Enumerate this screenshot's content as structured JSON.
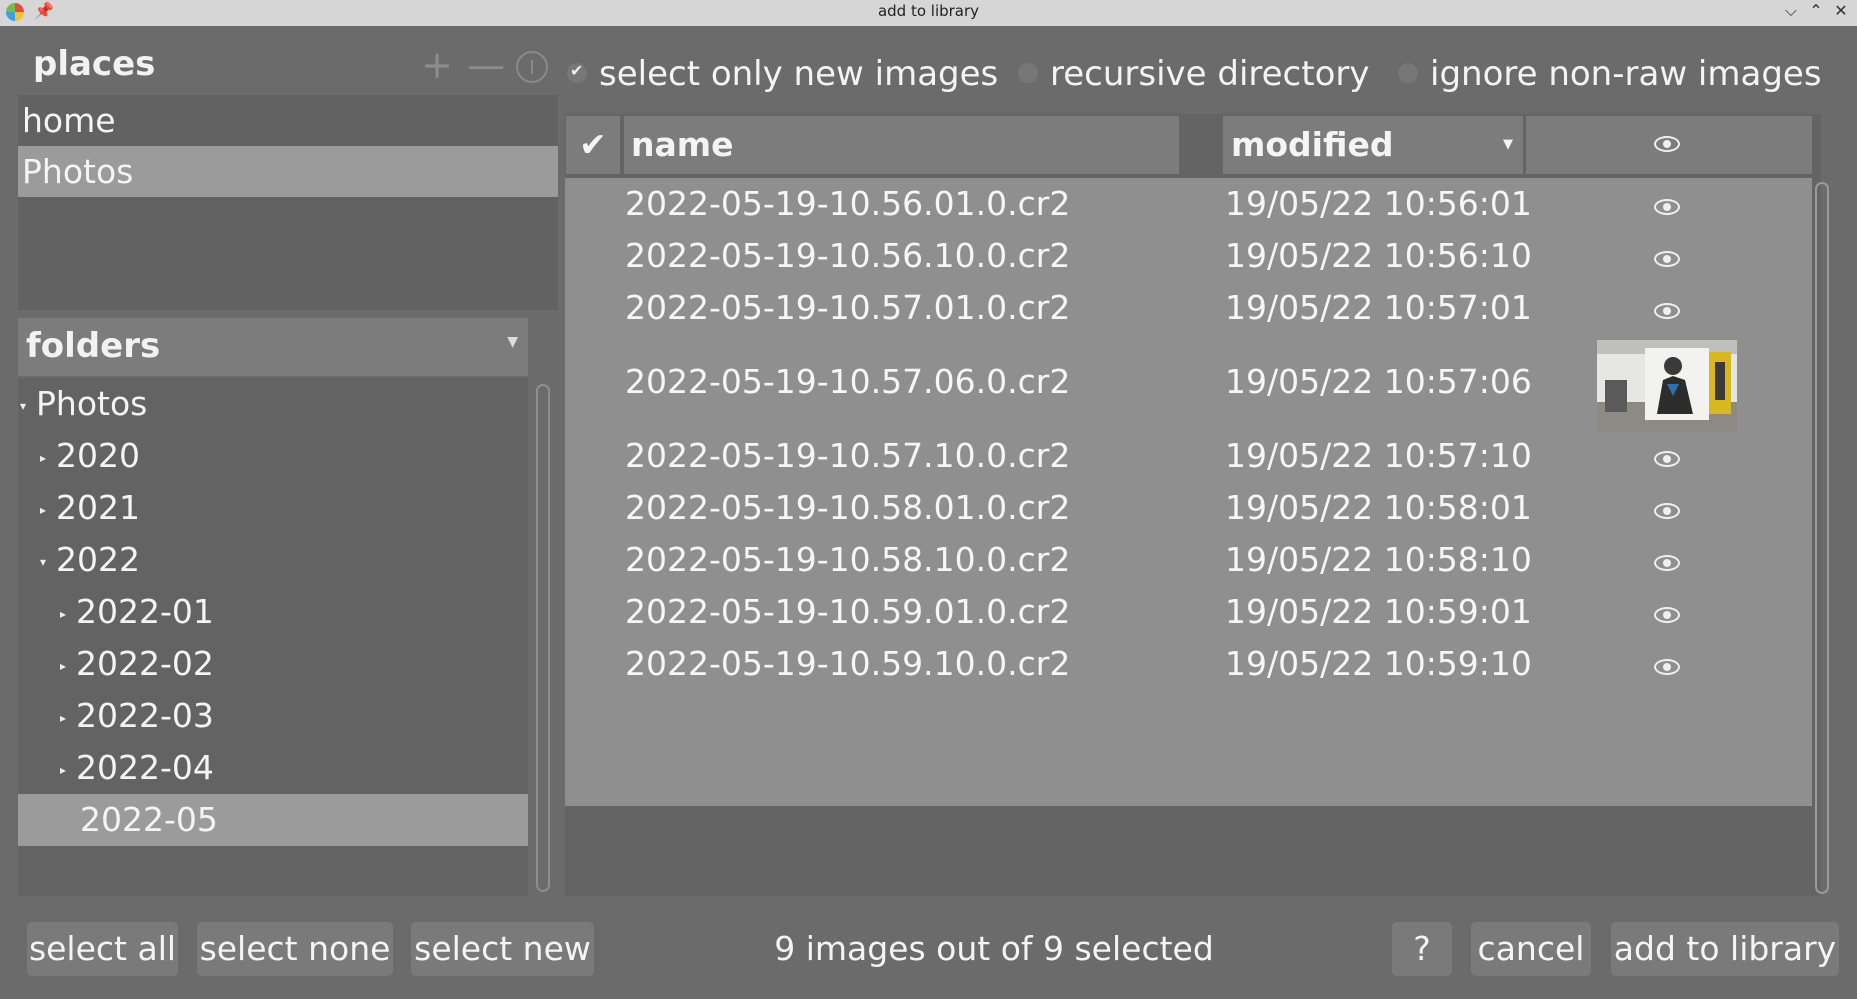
{
  "window": {
    "title": "add to library",
    "buttons": {
      "minimize": "⌵",
      "maximize": "⌃",
      "close": "✕"
    }
  },
  "places": {
    "title": "places",
    "add_label": "+",
    "remove_label": "—",
    "items": [
      {
        "label": "home",
        "selected": false
      },
      {
        "label": "Photos",
        "selected": true
      }
    ]
  },
  "folders": {
    "title": "folders",
    "items": [
      {
        "label": "Photos",
        "expanded": true,
        "selected": false
      },
      {
        "label": "2020",
        "expanded": false,
        "selected": false
      },
      {
        "label": "2021",
        "expanded": false,
        "selected": false
      },
      {
        "label": "2022",
        "expanded": true,
        "selected": false
      },
      {
        "label": "2022-01",
        "expanded": false,
        "selected": false
      },
      {
        "label": "2022-02",
        "expanded": false,
        "selected": false
      },
      {
        "label": "2022-03",
        "expanded": false,
        "selected": false
      },
      {
        "label": "2022-04",
        "expanded": false,
        "selected": false
      },
      {
        "label": "2022-05",
        "expanded": null,
        "selected": true
      }
    ]
  },
  "options": {
    "select_only_new": {
      "label": "select only new images",
      "checked": true
    },
    "recursive": {
      "label": "recursive directory",
      "checked": false
    },
    "ignore_nonraw": {
      "label": "ignore non-raw images",
      "checked": false
    }
  },
  "table": {
    "headers": {
      "check": "✔",
      "name": "name",
      "modified": "modified"
    },
    "rows": [
      {
        "name": "2022-05-19-10.56.01.0.cr2",
        "modified": "19/05/22 10:56:01",
        "preview": "eye-icon"
      },
      {
        "name": "2022-05-19-10.56.10.0.cr2",
        "modified": "19/05/22 10:56:10",
        "preview": "eye-icon"
      },
      {
        "name": "2022-05-19-10.57.01.0.cr2",
        "modified": "19/05/22 10:57:01",
        "preview": "eye-icon"
      },
      {
        "name": "2022-05-19-10.57.06.0.cr2",
        "modified": "19/05/22 10:57:06",
        "preview": "thumbnail"
      },
      {
        "name": "2022-05-19-10.57.10.0.cr2",
        "modified": "19/05/22 10:57:10",
        "preview": "eye-icon"
      },
      {
        "name": "2022-05-19-10.58.01.0.cr2",
        "modified": "19/05/22 10:58:01",
        "preview": "eye-icon"
      },
      {
        "name": "2022-05-19-10.58.10.0.cr2",
        "modified": "19/05/22 10:58:10",
        "preview": "eye-icon"
      },
      {
        "name": "2022-05-19-10.59.01.0.cr2",
        "modified": "19/05/22 10:59:01",
        "preview": "eye-icon"
      },
      {
        "name": "2022-05-19-10.59.10.0.cr2",
        "modified": "19/05/22 10:59:10",
        "preview": "eye-icon"
      }
    ]
  },
  "footer": {
    "select_all": "select all",
    "select_none": "select none",
    "select_new": "select new",
    "status": "9 images out of 9 selected",
    "help": "?",
    "cancel": "cancel",
    "add": "add to library"
  }
}
